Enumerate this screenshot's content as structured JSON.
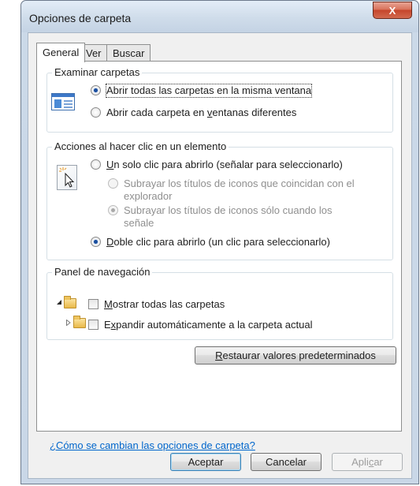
{
  "window": {
    "title": "Opciones de carpeta",
    "close_glyph": "X"
  },
  "tabs": [
    {
      "label": "General",
      "active": true
    },
    {
      "label": "Ver",
      "active": false
    },
    {
      "label": "Buscar",
      "active": false
    }
  ],
  "browse_folders": {
    "label": "Examinar carpetas",
    "options": [
      {
        "label": "Abrir todas las carpetas en la misma ventana",
        "checked": true
      },
      {
        "label_pre": "Abrir cada carpeta en ",
        "label_u": "v",
        "label_post": "entanas diferentes",
        "checked": false
      }
    ]
  },
  "click_items": {
    "label": "Acciones al hacer clic en un elemento",
    "single_click": {
      "label_u": "U",
      "label_post": "n solo clic para abrirlo (señalar para seleccionarlo)",
      "checked": false
    },
    "underline_consistent": {
      "label": "Subrayar los títulos de iconos que coincidan con el explorador",
      "checked": false,
      "disabled": true
    },
    "underline_hover": {
      "label": "Subrayar los títulos de iconos sólo cuando los señale",
      "checked": true,
      "disabled": true
    },
    "double_click": {
      "label_u": "D",
      "label_post": "oble clic para abrirlo (un clic para seleccionarlo)",
      "checked": true
    }
  },
  "nav_pane": {
    "label": "Panel de navegación",
    "show_all": {
      "label_u": "M",
      "label_post": "ostrar todas las carpetas",
      "checked": false
    },
    "auto_expand": {
      "label_pre": "E",
      "label_u": "x",
      "label_post": "pandir automáticamente a la carpeta actual",
      "checked": false
    }
  },
  "restore_button": {
    "label_u": "R",
    "label_post": "estaurar valores predeterminados"
  },
  "help_link": "¿Cómo se cambian las opciones de carpeta?",
  "footer": {
    "ok": "Aceptar",
    "cancel": "Cancelar",
    "apply_pre": "Apli",
    "apply_u": "c",
    "apply_post": "ar"
  },
  "colors": {
    "link": "#0066cc",
    "selected_radio": "#1a4e9e",
    "close_button": "#c5452b"
  }
}
